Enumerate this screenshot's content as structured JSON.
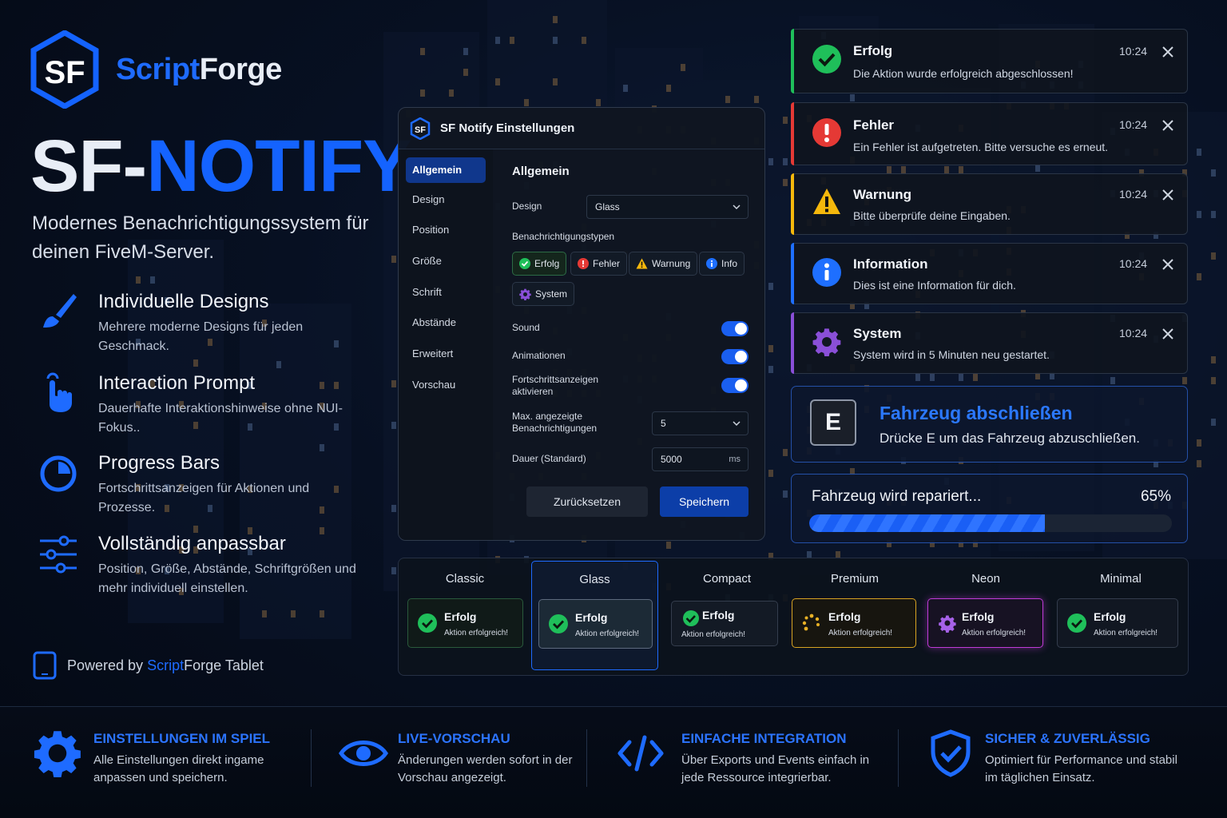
{
  "brand": {
    "name_a": "Script",
    "name_b": "Forge",
    "logo_text": "SF"
  },
  "hero": {
    "title_a": "SF-",
    "title_b": "NOTIFY",
    "tagline": "Modernes Benachrichtigungssystem für deinen FiveM-Server."
  },
  "features": [
    {
      "icon": "brush-icon",
      "title": "Individuelle Designs",
      "desc": "Mehrere moderne Designs für jeden Geschmack."
    },
    {
      "icon": "pointer-hand-icon",
      "title": "Interaction Prompt",
      "desc": "Dauerhafte Interaktionshinweise ohne NUI-Fokus.."
    },
    {
      "icon": "progress-icon",
      "title": "Progress Bars",
      "desc": "Fortschrittsanzeigen für Aktionen und Prozesse."
    },
    {
      "icon": "sliders-icon",
      "title": "Vollständig anpassbar",
      "desc": "Position, Größe, Abstände, Schriftgrößen und mehr individuell einstellen."
    }
  ],
  "powered": {
    "pre": "Powered by",
    "a": "Script",
    "b": "Forge",
    "post": "Tablet"
  },
  "settings": {
    "title": "SF Notify Einstellungen",
    "nav": [
      "Allgemein",
      "Design",
      "Position",
      "Größe",
      "Schrift",
      "Abstände",
      "Erweitert",
      "Vorschau"
    ],
    "active_nav": 0,
    "section": "Allgemein",
    "design_label": "Design",
    "design_value": "Glass",
    "types_label": "Benachrichtigungstypen",
    "types": [
      {
        "label": "Erfolg",
        "icon": "check-circle-icon"
      },
      {
        "label": "Fehler",
        "icon": "error-circle-icon"
      },
      {
        "label": "Warnung",
        "icon": "warning-triangle-icon"
      },
      {
        "label": "Info",
        "icon": "info-circle-icon"
      },
      {
        "label": "System",
        "icon": "gear-icon"
      }
    ],
    "sound_label": "Sound",
    "sound_on": true,
    "anim_label": "Animationen",
    "anim_on": true,
    "progress_label": "Fortschrittsanzeigen aktivieren",
    "progress_on": true,
    "max_label": "Max. angezeigte Benachrichtigungen",
    "max_value": "5",
    "duration_label": "Dauer (Standard)",
    "duration_value": "5000",
    "duration_unit": "ms",
    "reset_label": "Zurücksetzen",
    "save_label": "Speichern"
  },
  "notifications": [
    {
      "type": "success",
      "title": "Erfolg",
      "message": "Die Aktion wurde erfolgreich abgeschlossen!",
      "time": "10:24",
      "color": "#1fbf5a",
      "icon": "check-circle-icon"
    },
    {
      "type": "error",
      "title": "Fehler",
      "message": "Ein Fehler ist aufgetreten. Bitte versuche es erneut.",
      "time": "10:24",
      "color": "#e53935",
      "icon": "error-circle-icon"
    },
    {
      "type": "warning",
      "title": "Warnung",
      "message": "Bitte überprüfe deine Eingaben.",
      "time": "10:24",
      "color": "#f5b80c",
      "icon": "warning-triangle-icon"
    },
    {
      "type": "info",
      "title": "Information",
      "message": "Dies ist eine Information für dich.",
      "time": "10:24",
      "color": "#1e6fff",
      "icon": "info-circle-icon"
    },
    {
      "type": "system",
      "title": "System",
      "message": "System wird in 5 Minuten neu gestartet.",
      "time": "10:24",
      "color": "#8a4fd8",
      "icon": "gear-icon"
    }
  ],
  "prompt": {
    "key": "E",
    "title": "Fahrzeug abschließen",
    "text": "Drücke E um das Fahrzeug abzuschließen."
  },
  "progress": {
    "label": "Fahrzeug wird repariert...",
    "percent_text": "65%",
    "value": 0.65
  },
  "designs": [
    {
      "name": "Classic",
      "title": "Erfolg",
      "text": "Aktion erfolgreich!",
      "icon": "check-circle-icon",
      "border": "#2a5a3c"
    },
    {
      "name": "Glass",
      "title": "Erfolg",
      "text": "Aktion erfolgreich!",
      "icon": "check-circle-icon",
      "border": "#5d6a7d",
      "selected": true
    },
    {
      "name": "Compact",
      "title": "Erfolg",
      "text": "Aktion erfolgreich!",
      "icon": "check-circle-icon",
      "border": "#343d4d"
    },
    {
      "name": "Premium",
      "title": "Erfolg",
      "text": "Aktion erfolgreich!",
      "icon": "spinner-icon",
      "border": "#d8a322"
    },
    {
      "name": "Neon",
      "title": "Erfolg",
      "text": "Aktion erfolgreich!",
      "icon": "gear-icon",
      "border": "#c03bd8"
    },
    {
      "name": "Minimal",
      "title": "Erfolg",
      "text": "Aktion erfolgreich!",
      "icon": "check-circle-icon",
      "border": "#343d4d"
    }
  ],
  "footer": [
    {
      "icon": "gear-icon",
      "title": "EINSTELLUNGEN IM SPIEL",
      "desc": "Alle Einstellungen direkt ingame anpassen und speichern."
    },
    {
      "icon": "eye-icon",
      "title": "LIVE-VORSCHAU",
      "desc": "Änderungen werden sofort in der Vorschau angezeigt."
    },
    {
      "icon": "code-icon",
      "title": "EINFACHE INTEGRATION",
      "desc": "Über Exports und Events einfach in jede Ressource integrierbar."
    },
    {
      "icon": "shield-check-icon",
      "title": "SICHER & ZUVERLÄSSIG",
      "desc": "Optimiert für Performance und stabil im täglichen Einsatz."
    }
  ],
  "colors": {
    "accent": "#1e6bff",
    "success": "#1fbf5a",
    "error": "#e53935",
    "warning": "#f5b80c",
    "info": "#1e6fff",
    "system": "#8a4fd8"
  }
}
